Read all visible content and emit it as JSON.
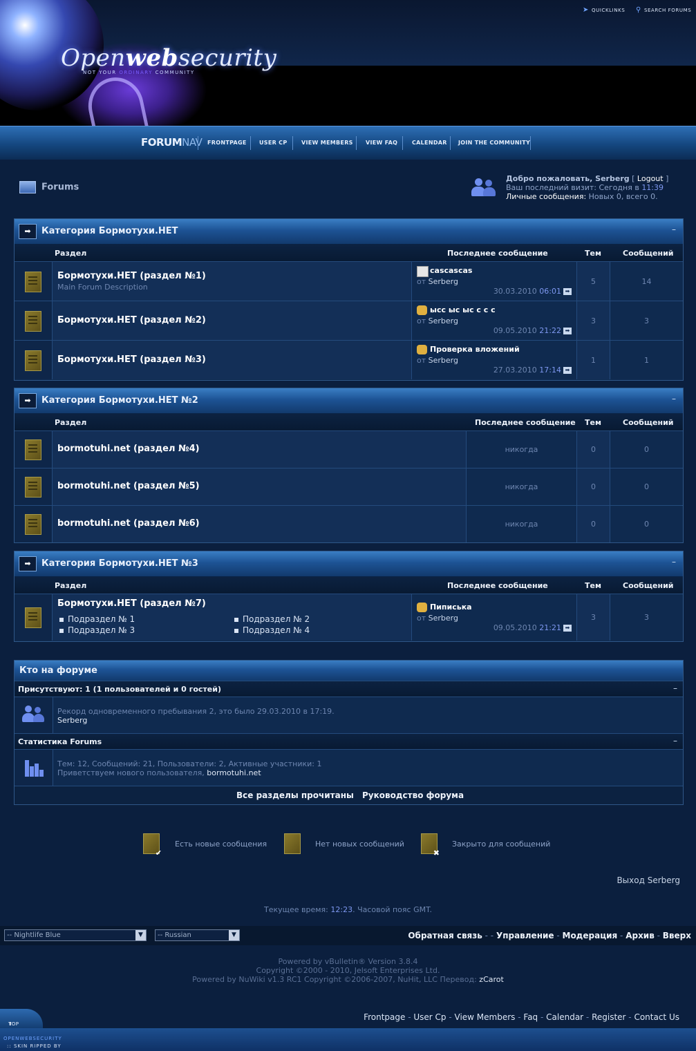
{
  "header": {
    "logo_open": "Open",
    "logo_web": "web",
    "logo_security": "security",
    "tagline_a": "NOT YOUR ",
    "tagline_b": "ORDINARY",
    "tagline_c": " COMMUNITY",
    "quicklinks": "QUICKLINKS",
    "search": "SEARCH FORUMS"
  },
  "nav": {
    "brand_a": "FORUM",
    "brand_b": "NAV",
    "items": [
      "FRONTPAGE",
      "USER CP",
      "VIEW MEMBERS",
      "VIEW FAQ",
      "CALENDAR",
      "JOIN THE COMMUNITY"
    ]
  },
  "page": {
    "title": "Forums"
  },
  "welcome": {
    "line1": "Добро пожаловать, ",
    "user": "Serberg",
    "logout_open": " [ ",
    "logout": "Logout",
    "logout_close": " ]",
    "line2": "Ваш последний визит: Сегодня в ",
    "last_time": "11:39",
    "line3": "Личные сообщения: ",
    "pm": "Новых 0, всего 0."
  },
  "columns": {
    "forum": "Раздел",
    "last": "Последнее сообщение",
    "threads": "Тем",
    "posts": "Сообщений"
  },
  "categories": [
    {
      "title": "Категория Бормотухи.НЕТ",
      "collapse": "–",
      "forums": [
        {
          "name": "Бормотухи.НЕТ (раздел №1)",
          "desc": "Main Forum Description",
          "last_title": "cascascas",
          "by": "от ",
          "user": "Serberg",
          "date": "30.03.2010 ",
          "time": "06:01",
          "threads": "5",
          "posts": "14"
        },
        {
          "name": "Бормотухи.НЕТ (раздел №2)",
          "desc": "",
          "last_title": "ысс ыс ыс с с с",
          "by": "от ",
          "user": "Serberg",
          "date": "09.05.2010 ",
          "time": "21:22",
          "threads": "3",
          "posts": "3"
        },
        {
          "name": "Бормотухи.НЕТ (раздел №3)",
          "desc": "",
          "last_title": "Проверка вложений",
          "by": "от ",
          "user": "Serberg",
          "date": "27.03.2010 ",
          "time": "17:14",
          "threads": "1",
          "posts": "1"
        }
      ]
    },
    {
      "title": "Категория Бормотухи.НЕТ №2",
      "collapse": "–",
      "forums": [
        {
          "name": "bormotuhi.net (раздел №4)",
          "never": "никогда",
          "threads": "0",
          "posts": "0"
        },
        {
          "name": "bormotuhi.net (раздел №5)",
          "never": "никогда",
          "threads": "0",
          "posts": "0"
        },
        {
          "name": "bormotuhi.net (раздел №6)",
          "never": "никогда",
          "threads": "0",
          "posts": "0"
        }
      ]
    },
    {
      "title": "Категория Бормотухи.НЕТ №3",
      "collapse": "–",
      "forums": [
        {
          "name": "Бормотухи.НЕТ (раздел №7)",
          "subforums": [
            "Подраздел № 1",
            "Подраздел № 2",
            "Подраздел № 3",
            "Подраздел № 4"
          ],
          "last_title": "Пиписька",
          "by": "от ",
          "user": "Serberg",
          "date": "09.05.2010 ",
          "time": "21:21",
          "threads": "3",
          "posts": "3"
        }
      ]
    }
  ],
  "online": {
    "title": "Кто на форуме",
    "present": "Присутствуют: 1 (1 пользователей и 0 гостей)",
    "collapse": "–",
    "record": "Рекорд одновременного пребывания 2, это было 29.03.2010 в 17:19.",
    "user": "Serberg",
    "stats_title": "Статистика Forums",
    "stats": "Тем: 12, Сообщений: 21, Пользователи: 2, Активные участники: 1",
    "welcome_new": "Приветствуем нового пользователя, ",
    "new_user": "bormotuhi.net",
    "mark_read": "Все разделы прочитаны",
    "guide": "Руководство форума"
  },
  "legend": {
    "new": "Есть новые сообщения",
    "no_new": "Нет новых сообщений",
    "closed": "Закрыто для сообщений"
  },
  "logout_line": "Выход Serberg",
  "current_time": {
    "pre": "Текущее время: ",
    "time": "12:23",
    "post": ". Часовой пояс GMT."
  },
  "footer": {
    "style_select": "-- Nightlife Blue",
    "lang_select": "-- Russian",
    "links": [
      "Обратная связь",
      "Управление",
      "Модерация",
      "Архив",
      "Вверх"
    ],
    "powered": "Powered by vBulletin® Version 3.8.4",
    "copyright": "Copyright ©2000 - 2010, Jelsoft Enterprises Ltd.",
    "nuwiki": "Powered by NuWiki v1.3 RC1 Copyright ©2006-2007, NuHit, LLC Перевод: ",
    "translator": "zCarot",
    "bottom_links": [
      "Frontpage",
      "User Cp",
      "View Members",
      "Faq",
      "Calendar",
      "Register",
      "Contact Us"
    ],
    "top": "TOP",
    "skin_a": ":: SKIN RIPPED BY ",
    "skin_b": "OPENWEBSECURITY"
  }
}
